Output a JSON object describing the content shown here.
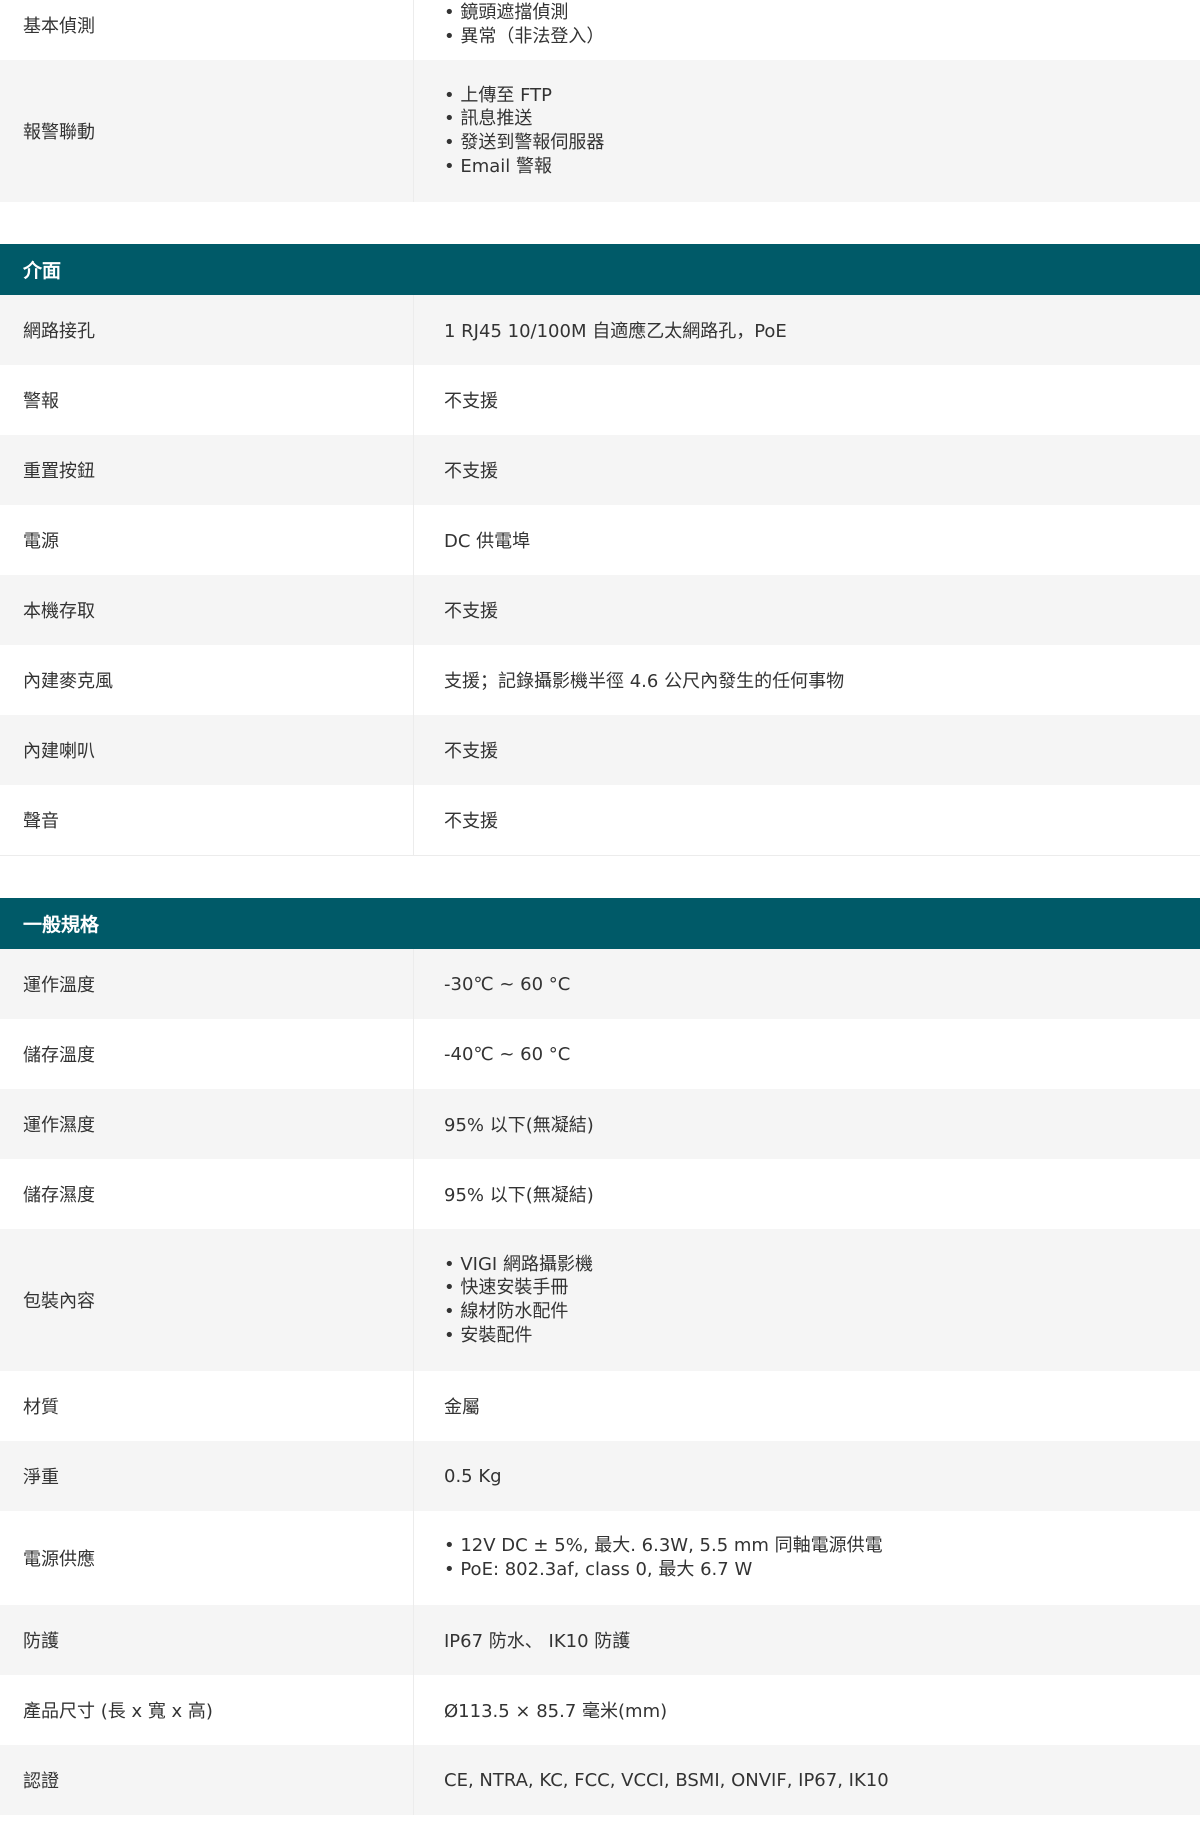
{
  "basic_detection": {
    "label": "基本偵測",
    "items": [
      "鏡頭遮擋偵測",
      "異常（非法登入）"
    ]
  },
  "alarm_linkage": {
    "label": "報警聯動",
    "items": [
      "上傳至 FTP",
      "訊息推送",
      "發送到警報伺服器",
      "Email 警報"
    ]
  },
  "sections": {
    "interface": {
      "title": "介面",
      "rows": [
        {
          "label": "網路接孔",
          "value": "1 RJ45 10/100M 自適應乙太網路孔，PoE"
        },
        {
          "label": "警報",
          "value": "不支援"
        },
        {
          "label": "重置按鈕",
          "value": "不支援"
        },
        {
          "label": "電源",
          "value": "DC 供電埠"
        },
        {
          "label": "本機存取",
          "value": "不支援"
        },
        {
          "label": "內建麥克風",
          "value": "支援；記錄攝影機半徑 4.6 公尺內發生的任何事物"
        },
        {
          "label": "內建喇叭",
          "value": "不支援"
        },
        {
          "label": "聲音",
          "value": "不支援"
        }
      ]
    },
    "general": {
      "title": "一般規格",
      "rows": [
        {
          "label": "運作溫度",
          "value": "-30℃ ~ 60 °C"
        },
        {
          "label": "儲存溫度",
          "value": "-40℃ ~ 60 °C"
        },
        {
          "label": "運作濕度",
          "value": "95% 以下(無凝結)"
        },
        {
          "label": "儲存濕度",
          "value": "95% 以下(無凝結)"
        }
      ],
      "package": {
        "label": "包裝內容",
        "items": [
          "VIGI 網路攝影機",
          "快速安裝手冊",
          "線材防水配件",
          "安裝配件"
        ]
      },
      "rows2": [
        {
          "label": "材質",
          "value": "金屬"
        },
        {
          "label": "淨重",
          "value": "0.5 Kg"
        }
      ],
      "power_supply": {
        "label": "電源供應",
        "items": [
          "12V DC ± 5%, 最大. 6.3W, 5.5 mm 同軸電源供電",
          "PoE: 802.3af, class 0, 最大 6.7 W"
        ]
      },
      "rows3": [
        {
          "label": "防護",
          "value": "IP67 防水、 IK10 防護"
        },
        {
          "label": "產品尺寸 (長 x 寬 x 高)",
          "value": "Ø113.5 × 85.7 毫米(mm)"
        },
        {
          "label": "認證",
          "value": "CE, NTRA, KC, FCC, VCCI, BSMI, ONVIF, IP67, IK10"
        }
      ]
    }
  },
  "colors": {
    "header_bg": "#005a68",
    "row_grey": "#f5f5f5",
    "text": "#333333"
  }
}
